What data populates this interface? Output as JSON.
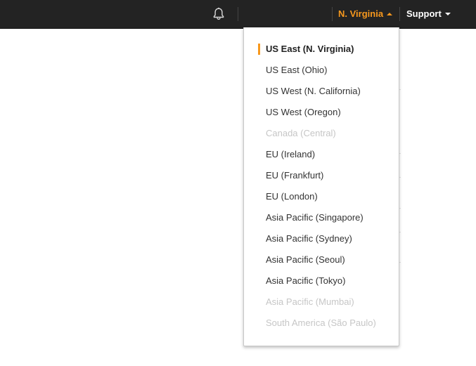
{
  "header": {
    "region_label": "N. Virginia",
    "support_label": "Support",
    "accent_color": "#f7981d",
    "icons": {
      "notifications": "bell-icon",
      "region_caret": "caret-up-icon",
      "support_caret": "caret-down-icon"
    }
  },
  "region_menu": {
    "items": [
      {
        "label": "US East (N. Virginia)",
        "state": "selected"
      },
      {
        "label": "US East (Ohio)",
        "state": "enabled"
      },
      {
        "label": "US West (N. California)",
        "state": "enabled"
      },
      {
        "label": "US West (Oregon)",
        "state": "enabled"
      },
      {
        "label": "Canada (Central)",
        "state": "disabled"
      },
      {
        "label": "EU (Ireland)",
        "state": "enabled"
      },
      {
        "label": "EU (Frankfurt)",
        "state": "enabled"
      },
      {
        "label": "EU (London)",
        "state": "enabled"
      },
      {
        "label": "Asia Pacific (Singapore)",
        "state": "enabled"
      },
      {
        "label": "Asia Pacific (Sydney)",
        "state": "enabled"
      },
      {
        "label": "Asia Pacific (Seoul)",
        "state": "enabled"
      },
      {
        "label": "Asia Pacific (Tokyo)",
        "state": "enabled"
      },
      {
        "label": "Asia Pacific (Mumbai)",
        "state": "disabled"
      },
      {
        "label": "South America (São Paulo)",
        "state": "disabled"
      }
    ]
  }
}
